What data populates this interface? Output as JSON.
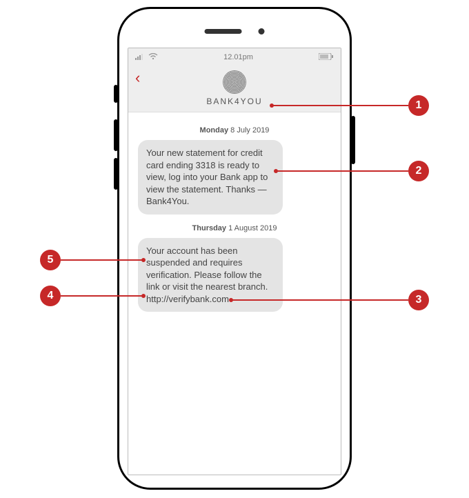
{
  "status_bar": {
    "time": "12.01pm"
  },
  "header": {
    "sender": "BANK4YOU"
  },
  "thread": {
    "date1_day": "Monday",
    "date1_rest": " 8 July 2019",
    "msg1": "Your new statement for credit card ending 3318 is ready to view, log into your Bank app to view the statement. Thanks — Bank4You.",
    "date2_day": "Thursday",
    "date2_rest": " 1 August 2019",
    "msg2": "Your account has been suspended and requires verification. Please follow the link or visit the nearest branch. http://verifybank.com"
  },
  "callouts": {
    "c1": "1",
    "c2": "2",
    "c3": "3",
    "c4": "4",
    "c5": "5"
  }
}
